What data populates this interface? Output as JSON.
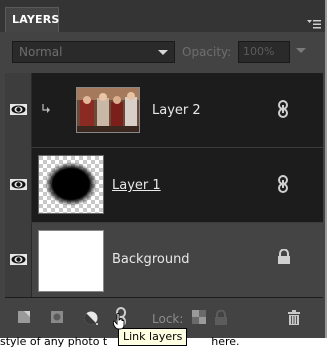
{
  "panel": {
    "title": "LAYERS",
    "blend_mode": "Normal",
    "opacity_label": "Opacity:",
    "opacity_value": "100%"
  },
  "layers": [
    {
      "name": "Layer 2",
      "visible": true,
      "thumbnail": "photo",
      "link": "chain-icon"
    },
    {
      "name": "Layer 1",
      "visible": true,
      "thumbnail": "black-blob-on-transparent",
      "link": "chain-icon"
    },
    {
      "name": "Background",
      "visible": true,
      "thumbnail": "white",
      "lock": "lock-icon"
    }
  ],
  "toolbar": {
    "lock_label": "Lock:",
    "tooltip": "Link layers"
  },
  "status": {
    "left_text": "style of any photo t",
    "right_text": "here."
  },
  "colors": {
    "panel_bg": "#434343",
    "list_bg": "#1c1c1c",
    "tooltip_bg": "#ffffe1"
  }
}
